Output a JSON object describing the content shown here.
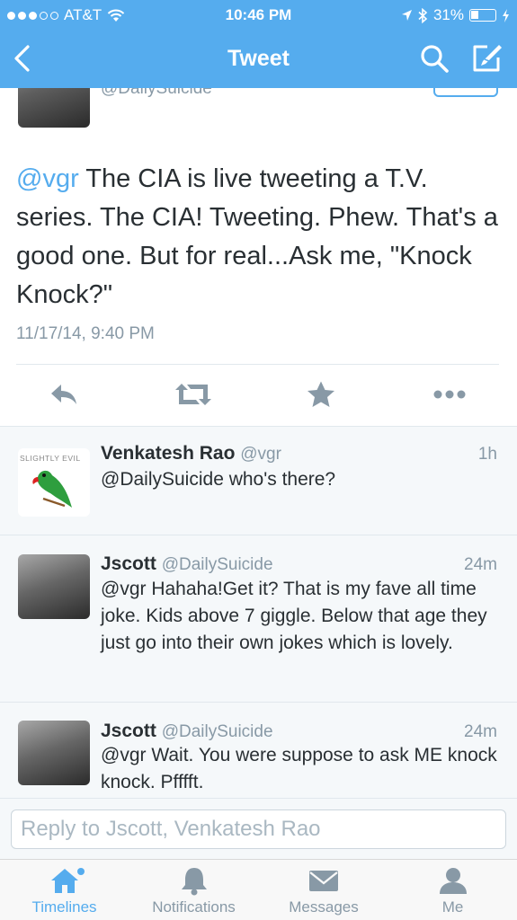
{
  "status_bar": {
    "carrier": "AT&T",
    "time": "10:46 PM",
    "battery": "31%",
    "battery_level": 0.31
  },
  "nav": {
    "title": "Tweet",
    "back_icon": "chevron-left-icon",
    "search_icon": "search-icon",
    "compose_icon": "compose-icon"
  },
  "main_tweet": {
    "handle": "@DailySuicide",
    "mention": "@vgr",
    "text": " The CIA is live tweeting a T.V. series.  The CIA!  Tweeting.  Phew. That's a good one.  But for real...Ask me, \"Knock Knock?\"",
    "timestamp": "11/17/14, 9:40 PM",
    "actions": [
      "reply-icon",
      "retweet-icon",
      "favorite-icon",
      "more-icon"
    ]
  },
  "replies": [
    {
      "name": "Venkatesh Rao",
      "handle": "@vgr",
      "time": "1h",
      "text": "@DailySuicide who's there?",
      "avatar_text": "SLIGHTLY EVIL"
    },
    {
      "name": "Jscott",
      "handle": "@DailySuicide",
      "time": "24m",
      "text": "@vgr Hahaha!Get it? That is my fave all time joke.  Kids above 7 giggle. Below that age they just go into their own jokes which is lovely."
    },
    {
      "name": "Jscott",
      "handle": "@DailySuicide",
      "time": "24m",
      "text": "@vgr Wait.  You were suppose to ask ME knock knock.  Pfffft."
    }
  ],
  "reply_box": {
    "placeholder": "Reply to Jscott, Venkatesh Rao"
  },
  "tabs": [
    {
      "label": "Timelines",
      "icon": "home-icon",
      "active": true
    },
    {
      "label": "Notifications",
      "icon": "bell-icon",
      "active": false
    },
    {
      "label": "Messages",
      "icon": "envelope-icon",
      "active": false
    },
    {
      "label": "Me",
      "icon": "person-icon",
      "active": false
    }
  ],
  "colors": {
    "brand": "#55acee",
    "text": "#292f33",
    "muted": "#8899a6",
    "background_alt": "#f5f8fa"
  }
}
